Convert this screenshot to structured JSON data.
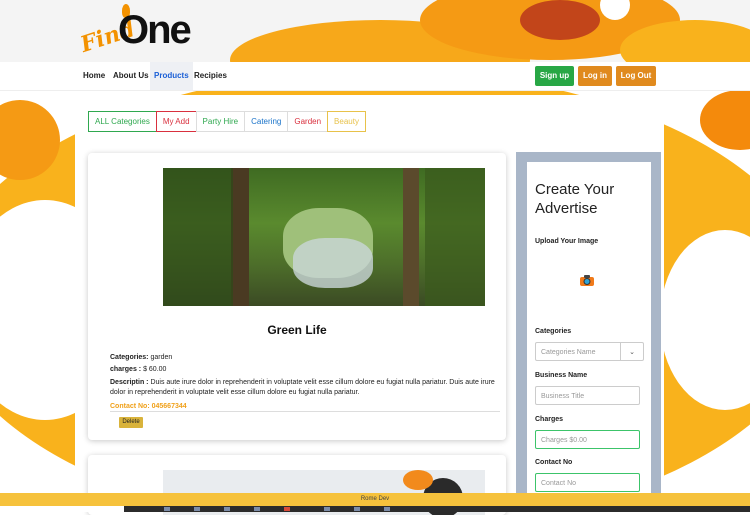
{
  "logo": {
    "script_text": "Find",
    "bold_text": "One"
  },
  "nav": {
    "links": [
      "Home",
      "About Us",
      "Products",
      "Recipies"
    ],
    "active": "Products",
    "buttons": {
      "signup": "Sign up",
      "login": "Log in",
      "logout": "Log Out"
    }
  },
  "tabs": [
    {
      "label": "ALL Categories",
      "color": "#2fa84f"
    },
    {
      "label": "My Add",
      "color": "#d9303e"
    },
    {
      "label": "Party Hire",
      "color": "#2fa84f"
    },
    {
      "label": "Catering",
      "color": "#1a73c9"
    },
    {
      "label": "Garden",
      "color": "#d9303e"
    },
    {
      "label": "Beauty",
      "color": "#e8c24a"
    }
  ],
  "listing": {
    "title": "Green Life",
    "categories_label": "Categories:",
    "categories_value": "garden",
    "charges_label": "charges :",
    "charges_value": "$ 60.00",
    "description_label": "Descriptin :",
    "description_value": "Duis aute irure dolor in reprehenderit in voluptate velit esse cillum dolore eu fugiat nulla pariatur. Duis aute irure dolor in reprehenderit in voluptate velit esse cillum dolore eu fugiat nulla pariatur.",
    "contact": "Contact No: 045667344",
    "delete_label": "Delete"
  },
  "sidebar": {
    "title": "Create Your Advertise",
    "upload_label": "Upload Your Image",
    "categories_label": "Categories",
    "categories_placeholder": "Categories Name",
    "business_label": "Business Name",
    "business_placeholder": "Business Title",
    "charges_label": "Charges",
    "charges_placeholder": "Charges $0.00",
    "contact_label": "Contact No",
    "contact_placeholder": "Contact No"
  },
  "footer": {
    "text": "Rome Dev"
  },
  "colors": {
    "accent_orange": "#f7a81a",
    "signup_green": "#28a745",
    "login_orange": "#e08a1e"
  }
}
